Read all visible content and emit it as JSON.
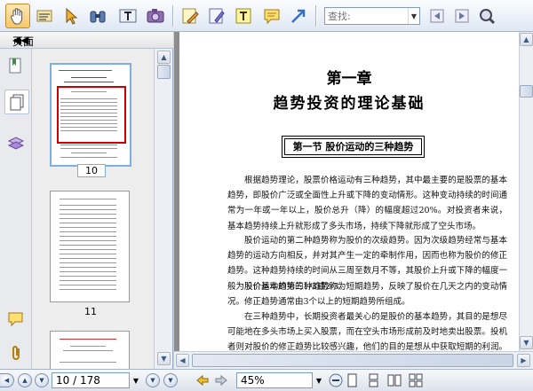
{
  "toolbar": {
    "tools": [
      "hand-tool",
      "select-text-tool",
      "pointer-tool",
      "binoculars-tool",
      "text-select-tool",
      "snapshot-tool",
      "pencil-tool",
      "highlight-tool",
      "typewriter-tool",
      "note-tool",
      "arrow-tool"
    ],
    "find_placeholder": "查找:"
  },
  "left_panel": {
    "title": "页面",
    "thumbnails": [
      {
        "label": "10",
        "selected": true
      },
      {
        "label": "11",
        "selected": false
      }
    ]
  },
  "document": {
    "chapter_number": "第一章",
    "chapter_title": "趋势投资的理论基础",
    "section_title": "第一节 股价运动的三种趋势",
    "paragraphs": [
      "根据趋势理论，股票价格运动有三种趋势，其中最主要的是股票的基本趋势，即股价广泛或全面性上升或下降的变动情形。这种变动持续的时间通常为一年或一年以上，股价总升（降）的幅度超过20%。对投资者来说，基本趋势持续上升就形成了多头市场，持续下降就形成了空头市场。",
      "股价运动的第二种趋势称为股价的次级趋势。因为次级趋势经常与基本趋势的运动方向相反，并对其产生一定的牵制作用，因而也称为股价的修正趋势。这种趋势持续的时间从三周至数月不等，其股价上升或下降的幅度一般为股价基本趋势的1/3或2/3。",
      "股价运动的第三种趋势称为短期趋势，反映了股价在几天之内的变动情况。修正趋势通常由3个以上的短期趋势所组成。",
      "在三种趋势中，长期投资者最关心的是股价的基本趋势，其目的是想尽可能地在多头市场上买入股票，而在空头市场形成前及时地卖出股票。投机者则对股价的修正趋势比较感兴趣，他们的目的是想从中获取短期的利润。短期趋势的重要性较小，且易受人为操纵，因而不便作为趋势分析"
    ]
  },
  "status_bar": {
    "page_field": "10 / 178",
    "zoom_field": "45%"
  },
  "colors": {
    "thumbnail_selection": "#7cb0e0",
    "toolbar_bg": "#dfe8f5",
    "workspace_bg": "#8d8d8d"
  }
}
